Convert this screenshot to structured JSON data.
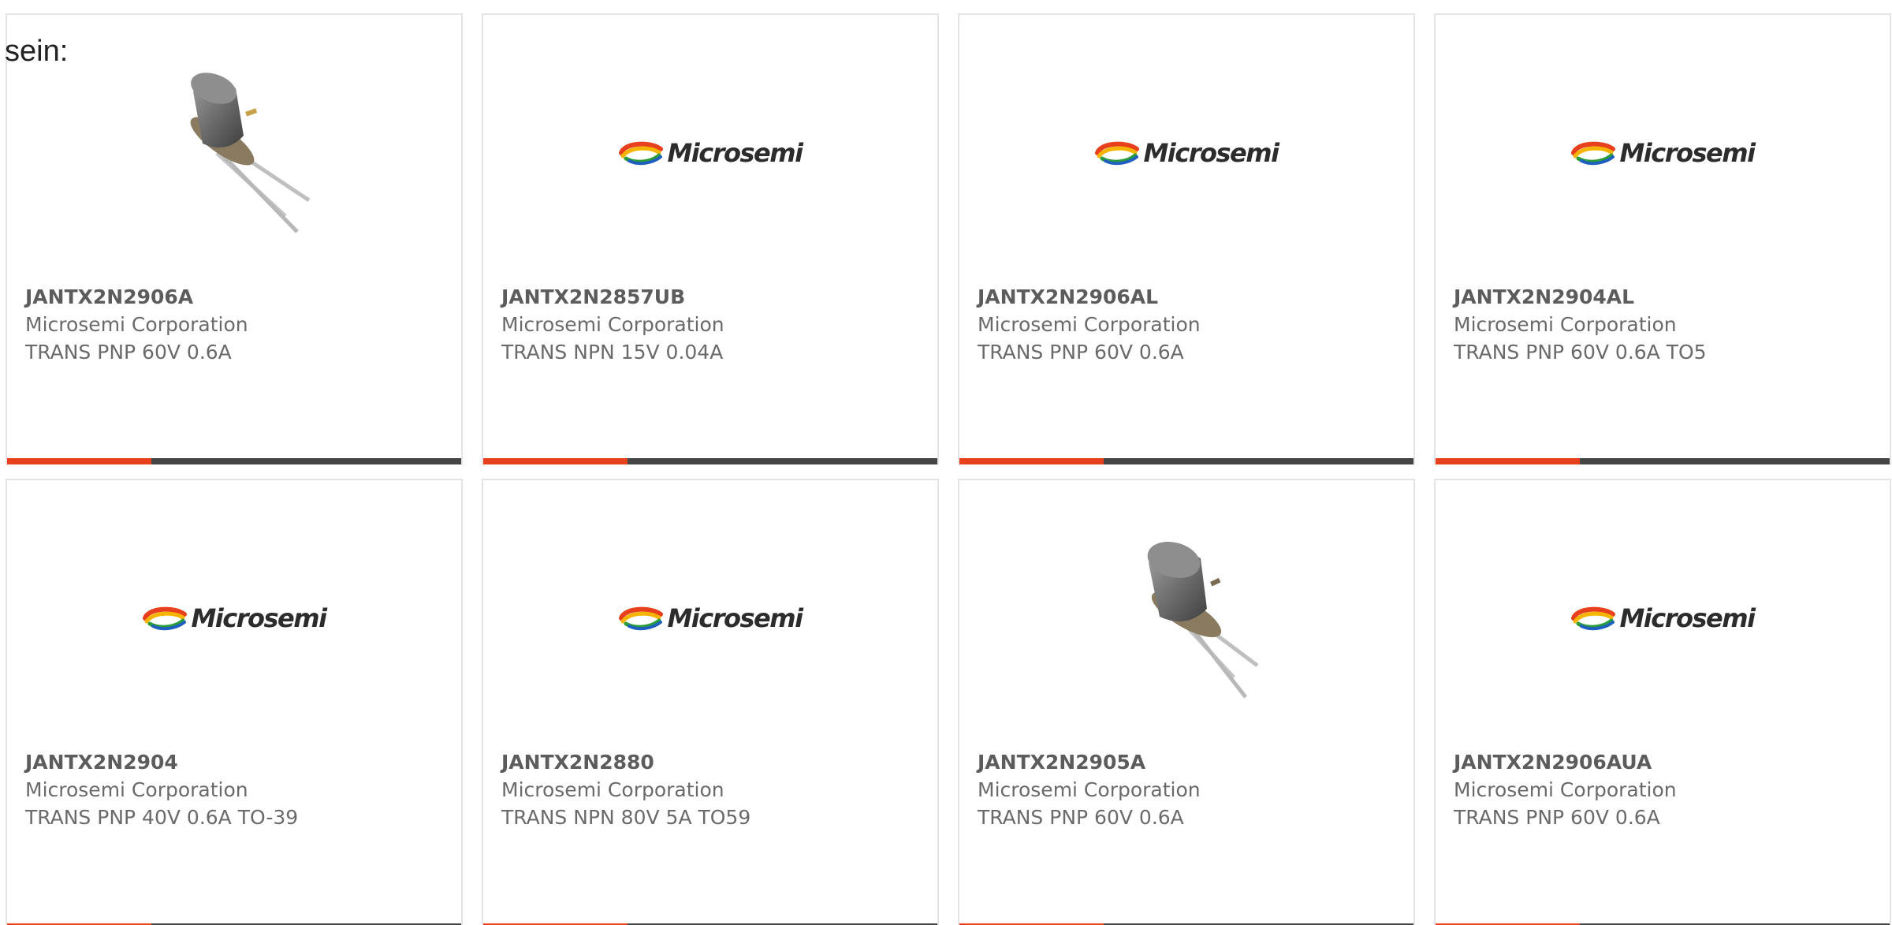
{
  "intro_text": "sein:",
  "brand": {
    "logo_text": "Microsemi",
    "accent_color": "#e8401c",
    "bar_color": "#454545"
  },
  "products": [
    {
      "part_number": "JANTX2N2906A",
      "manufacturer": "Microsemi Corporation",
      "description": "TRANS PNP 60V 0.6A",
      "image": "transistor-photo"
    },
    {
      "part_number": "JANTX2N2857UB",
      "manufacturer": "Microsemi Corporation",
      "description": "TRANS NPN 15V 0.04A",
      "image": "microsemi-logo"
    },
    {
      "part_number": "JANTX2N2906AL",
      "manufacturer": "Microsemi Corporation",
      "description": "TRANS PNP 60V 0.6A",
      "image": "microsemi-logo"
    },
    {
      "part_number": "JANTX2N2904AL",
      "manufacturer": "Microsemi Corporation",
      "description": "TRANS PNP 60V 0.6A TO5",
      "image": "microsemi-logo"
    },
    {
      "part_number": "JANTX2N2904",
      "manufacturer": "Microsemi Corporation",
      "description": "TRANS PNP 40V 0.6A TO-39",
      "image": "microsemi-logo"
    },
    {
      "part_number": "JANTX2N2880",
      "manufacturer": "Microsemi Corporation",
      "description": "TRANS NPN 80V 5A TO59",
      "image": "microsemi-logo"
    },
    {
      "part_number": "JANTX2N2905A",
      "manufacturer": "Microsemi Corporation",
      "description": "TRANS PNP 60V 0.6A",
      "image": "transistor-photo"
    },
    {
      "part_number": "JANTX2N2906AUA",
      "manufacturer": "Microsemi Corporation",
      "description": "TRANS PNP 60V 0.6A",
      "image": "microsemi-logo"
    }
  ]
}
